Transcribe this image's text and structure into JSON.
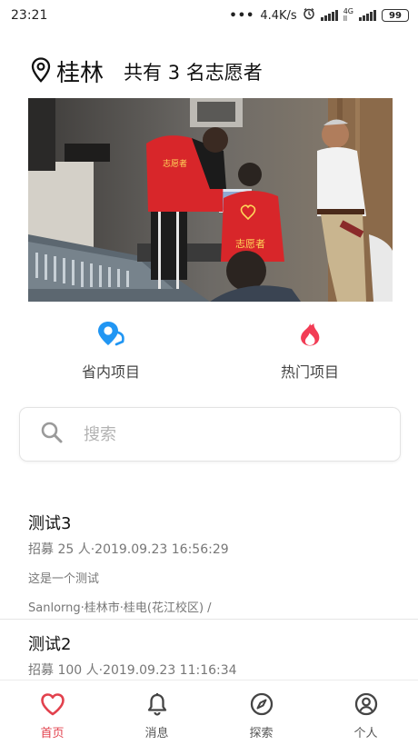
{
  "status_bar": {
    "time": "23:21",
    "network_speed": "4.4K/s",
    "network_type": "4G",
    "battery": "99"
  },
  "header": {
    "city": "桂林",
    "volunteer_count": "共有 3 名志愿者"
  },
  "banner": {
    "vest_text_1": "志愿者",
    "vest_text_2": "志愿者"
  },
  "categories": [
    {
      "label": "省内项目",
      "icon": "map-pin-icon",
      "color": "#2196f3"
    },
    {
      "label": "热门项目",
      "icon": "flame-icon",
      "color": "#f23c55"
    }
  ],
  "search": {
    "placeholder": "搜索"
  },
  "projects": [
    {
      "title": "测试3",
      "meta": "招募 25 人·2019.09.23 16:56:29",
      "description": "这是一个测试",
      "address": "Sanlorng·桂林市·桂电(花江校区) /"
    },
    {
      "title": "测试2",
      "meta": "招募 100 人·2019.09.23 11:16:34"
    }
  ],
  "tabs": [
    {
      "label": "首页",
      "icon": "heart-icon",
      "active": true
    },
    {
      "label": "消息",
      "icon": "bell-icon",
      "active": false
    },
    {
      "label": "探索",
      "icon": "compass-icon",
      "active": false
    },
    {
      "label": "个人",
      "icon": "user-icon",
      "active": false
    }
  ],
  "colors": {
    "accent": "#e2414d",
    "blue": "#2196f3",
    "hot": "#f23c55",
    "vest": "#d8262a"
  }
}
